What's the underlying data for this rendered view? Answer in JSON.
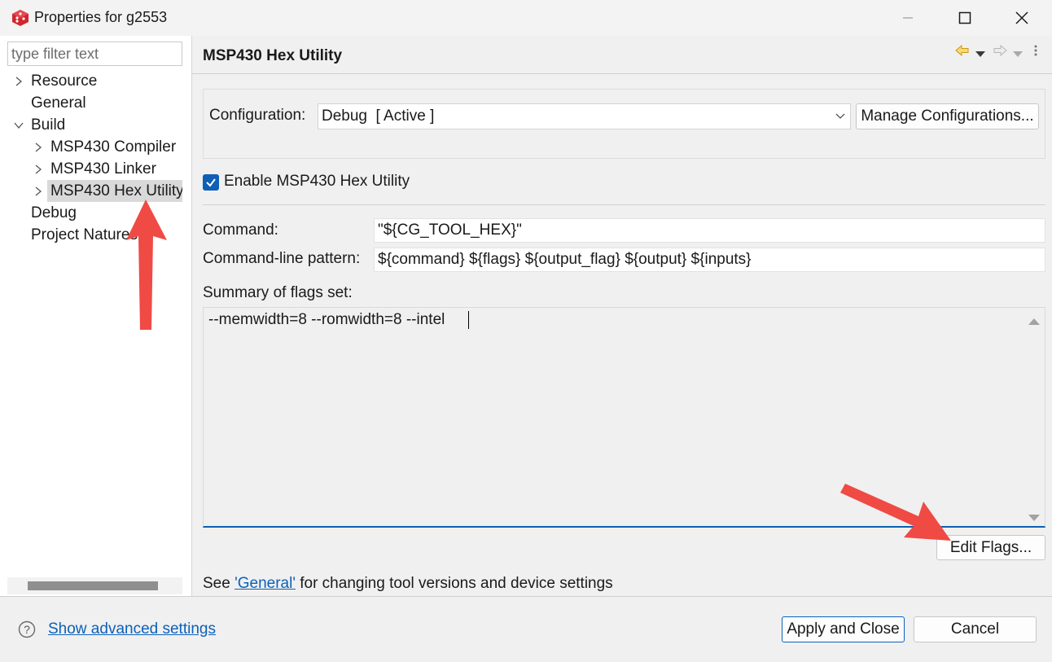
{
  "window": {
    "title": "Properties for g2553",
    "icon": "red-cube-app-icon"
  },
  "filter": {
    "placeholder": "type filter text"
  },
  "tree": {
    "resource": "Resource",
    "general": "General",
    "build": "Build",
    "compiler": "MSP430 Compiler",
    "linker": "MSP430 Linker",
    "hex_utility": "MSP430 Hex Utility",
    "debug": "Debug",
    "project_natures": "Project Natures",
    "selected": "MSP430 Hex Utility"
  },
  "page": {
    "title": "MSP430 Hex Utility",
    "configuration_label": "Configuration:",
    "configuration_value": "Debug  [ Active ]",
    "manage_button": "Manage Configurations...",
    "enable_label": "Enable MSP430 Hex Utility",
    "enable_checked": true,
    "command_label": "Command:",
    "command_value": "\"${CG_TOOL_HEX}\"",
    "pattern_label": "Command-line pattern:",
    "pattern_value": "${command} ${flags} ${output_flag} ${output} ${inputs}",
    "summary_label": "Summary of flags set:",
    "summary_value": "--memwidth=8 --romwidth=8 --intel",
    "edit_flags_button": "Edit Flags...",
    "footer_prefix": "See ",
    "footer_link": "'General'",
    "footer_suffix": " for changing tool versions and device settings"
  },
  "bottom": {
    "advanced_link": "Show advanced settings",
    "apply_button": "Apply and Close",
    "cancel_button": "Cancel"
  },
  "colors": {
    "accent": "#0b61b9",
    "annotation_arrow": "#f04a45",
    "checkbox": "#0f5fb6"
  }
}
